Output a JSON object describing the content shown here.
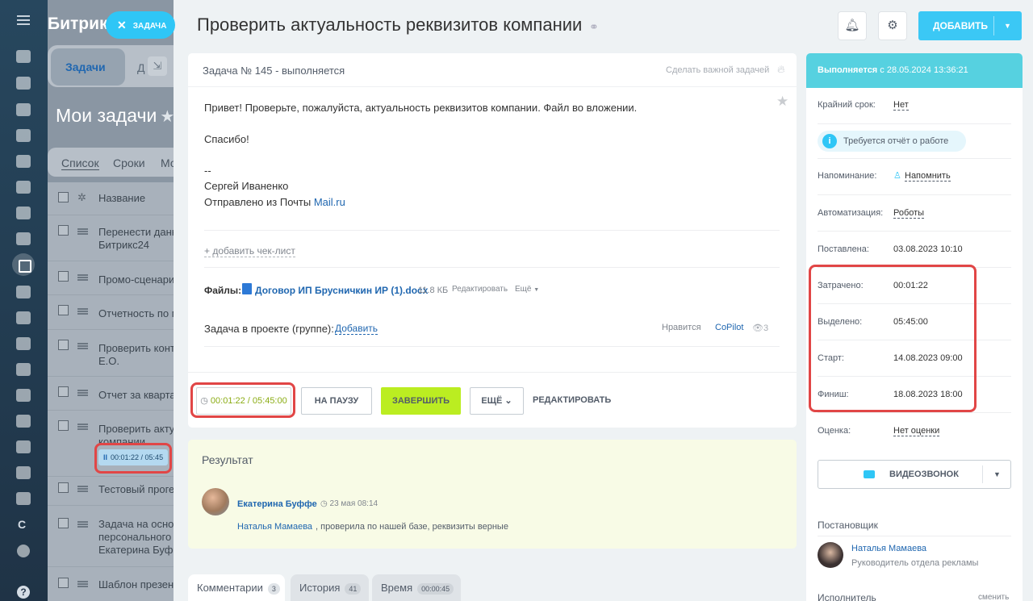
{
  "app": {
    "logo": "Битрикс",
    "task_chip": "ЗАДАЧА"
  },
  "background_list": {
    "tab_active": "Задачи",
    "tab_second": "Д",
    "title": "Мои задачи",
    "views": [
      "Список",
      "Сроки",
      "Мо"
    ],
    "column_name": "Название",
    "rows": [
      [
        "Перенести данн",
        "Битрикс24"
      ],
      [
        "Промо-сценари"
      ],
      [
        "Отчетность по м"
      ],
      [
        "Проверить конт",
        "Е.О."
      ],
      [
        "Отчет за кварта"
      ],
      [
        "Проверить актуа",
        "компании"
      ],
      [
        "Тестовый проге"
      ],
      [
        "Задача на осно",
        "персонального",
        "Екатерина Буфф"
      ],
      [
        "Шаблон презен"
      ]
    ],
    "row_timer": "00:01:22 / 05:45"
  },
  "header": {
    "title": "Проверить актуальность реквизитов компании",
    "add_button": "ДОБАВИТЬ"
  },
  "task": {
    "number_status": "Задача № 145 - выполняется",
    "make_important": "Сделать важной задачей",
    "description": {
      "line1": "Привет! Проверьте, пожалуйста, актуальность реквизитов компании. Файл во вложении.",
      "line2": "Спасибо!",
      "line3": "--",
      "line4": "Сергей Иваненко",
      "line5_prefix": "Отправлено из Почты ",
      "line5_link": "Mail.ru"
    },
    "add_checklist": "+ добавить чек-лист",
    "files_label": "Файлы:",
    "file_name": "Договор ИП Брусничкин ИР (1).docx",
    "file_size": "11.8 КБ",
    "file_edit": "Редактировать",
    "file_more": "Ещё",
    "project_label": "Задача в проекте (группе):",
    "project_add": "Добавить",
    "like": "Нравится",
    "copilot": "CoPilot",
    "views": "3",
    "timer": "00:01:22 / 05:45:00",
    "pause": "НА ПАУЗУ",
    "finish": "ЗАВЕРШИТЬ",
    "more": "ЕЩЁ",
    "edit": "РЕДАКТИРОВАТЬ"
  },
  "result": {
    "title": "Результат",
    "author": "Екатерина Буффе",
    "date": "23 мая 08:14",
    "mention": "Наталья Мамаева",
    "text": ", проверила по нашей базе, реквизиты верные"
  },
  "bottom_tabs": [
    {
      "label": "Комментарии",
      "count": "3"
    },
    {
      "label": "История",
      "count": "41"
    },
    {
      "label": "Время",
      "count": "00:00:45"
    }
  ],
  "sidebar": {
    "status_bold": "Выполняется",
    "status_rest": "с 28.05.2024 13:36:21",
    "deadline_label": "Крайний срок:",
    "deadline_value": "Нет",
    "report_required": "Требуется отчёт о работе",
    "reminder_label": "Напоминание:",
    "reminder_value": "Напомнить",
    "automation_label": "Автоматизация:",
    "automation_value": "Роботы",
    "created_label": "Поставлена:",
    "created_value": "03.08.2023 10:10",
    "spent_label": "Затрачено:",
    "spent_value": "00:01:22",
    "allocated_label": "Выделено:",
    "allocated_value": "05:45:00",
    "start_label": "Старт:",
    "start_value": "14.08.2023 09:00",
    "finish_label": "Финиш:",
    "finish_value": "18.08.2023 18:00",
    "rating_label": "Оценка:",
    "rating_value": "Нет оценки",
    "video_call": "ВИДЕОЗВОНОК",
    "creator_label": "Постановщик",
    "creator_name": "Наталья Мамаева",
    "creator_role": "Руководитель отдела рекламы",
    "assignee_label": "Исполнитель",
    "assignee_change": "сменить"
  },
  "colors": {
    "accent": "#3bc8f5",
    "status": "#56d1e0",
    "finish": "#bbed21",
    "highlight": "#e14646"
  }
}
